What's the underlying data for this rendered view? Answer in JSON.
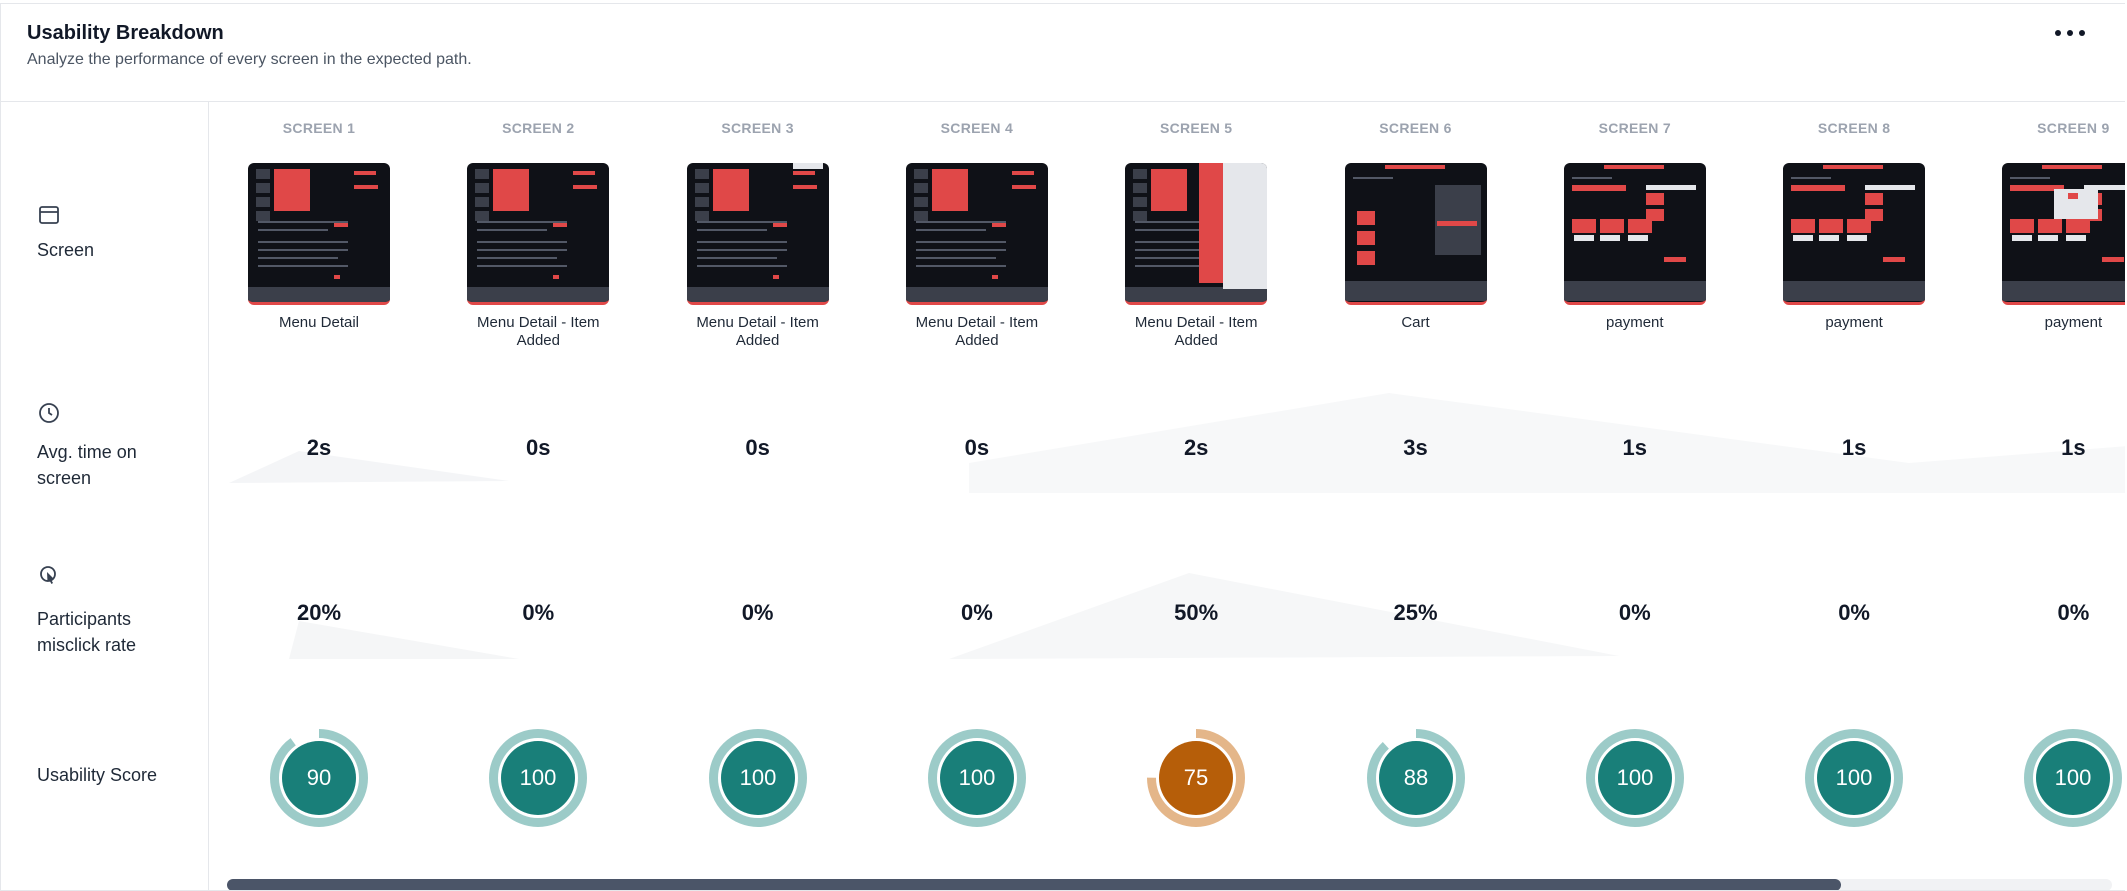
{
  "header": {
    "title": "Usability Breakdown",
    "subtitle": "Analyze the performance of every screen in the expected path."
  },
  "rows": {
    "screen": "Screen",
    "time": "Avg. time on screen",
    "misclick": "Participants misclick rate",
    "score": "Usability Score"
  },
  "icons": {
    "screen": "window-icon",
    "time": "clock-icon",
    "misclick": "cursor-click-icon",
    "more": "more-options-icon"
  },
  "screens": [
    {
      "header": "SCREEN 1",
      "name": "Menu Detail",
      "time": "2s",
      "misclick": "20%",
      "score": 90,
      "score_label": "90",
      "color": "teal"
    },
    {
      "header": "SCREEN 2",
      "name": "Menu Detail - Item Added",
      "time": "0s",
      "misclick": "0%",
      "score": 100,
      "score_label": "100",
      "color": "teal"
    },
    {
      "header": "SCREEN 3",
      "name": "Menu Detail - Item Added",
      "time": "0s",
      "misclick": "0%",
      "score": 100,
      "score_label": "100",
      "color": "teal"
    },
    {
      "header": "SCREEN 4",
      "name": "Menu Detail - Item Added",
      "time": "0s",
      "misclick": "0%",
      "score": 100,
      "score_label": "100",
      "color": "teal"
    },
    {
      "header": "SCREEN 5",
      "name": "Menu Detail - Item Added",
      "time": "2s",
      "misclick": "50%",
      "score": 75,
      "score_label": "75",
      "color": "orange"
    },
    {
      "header": "SCREEN 6",
      "name": "Cart",
      "time": "3s",
      "misclick": "25%",
      "score": 88,
      "score_label": "88",
      "color": "teal"
    },
    {
      "header": "SCREEN 7",
      "name": "payment",
      "time": "1s",
      "misclick": "0%",
      "score": 100,
      "score_label": "100",
      "color": "teal"
    },
    {
      "header": "SCREEN 8",
      "name": "payment",
      "time": "1s",
      "misclick": "0%",
      "score": 100,
      "score_label": "100",
      "color": "teal"
    },
    {
      "header": "SCREEN 9",
      "name": "payment",
      "time": "1s",
      "misclick": "0%",
      "score": 100,
      "score_label": "100",
      "color": "teal"
    }
  ],
  "colors": {
    "teal": "#197f79",
    "teal_ring": "#9ccbc8",
    "orange": "#b65e09",
    "orange_ring": "#e4b689",
    "thumb_bg": "#0f1117",
    "thumb_accent": "#e04848"
  },
  "scroll": {
    "position": 0.86
  }
}
